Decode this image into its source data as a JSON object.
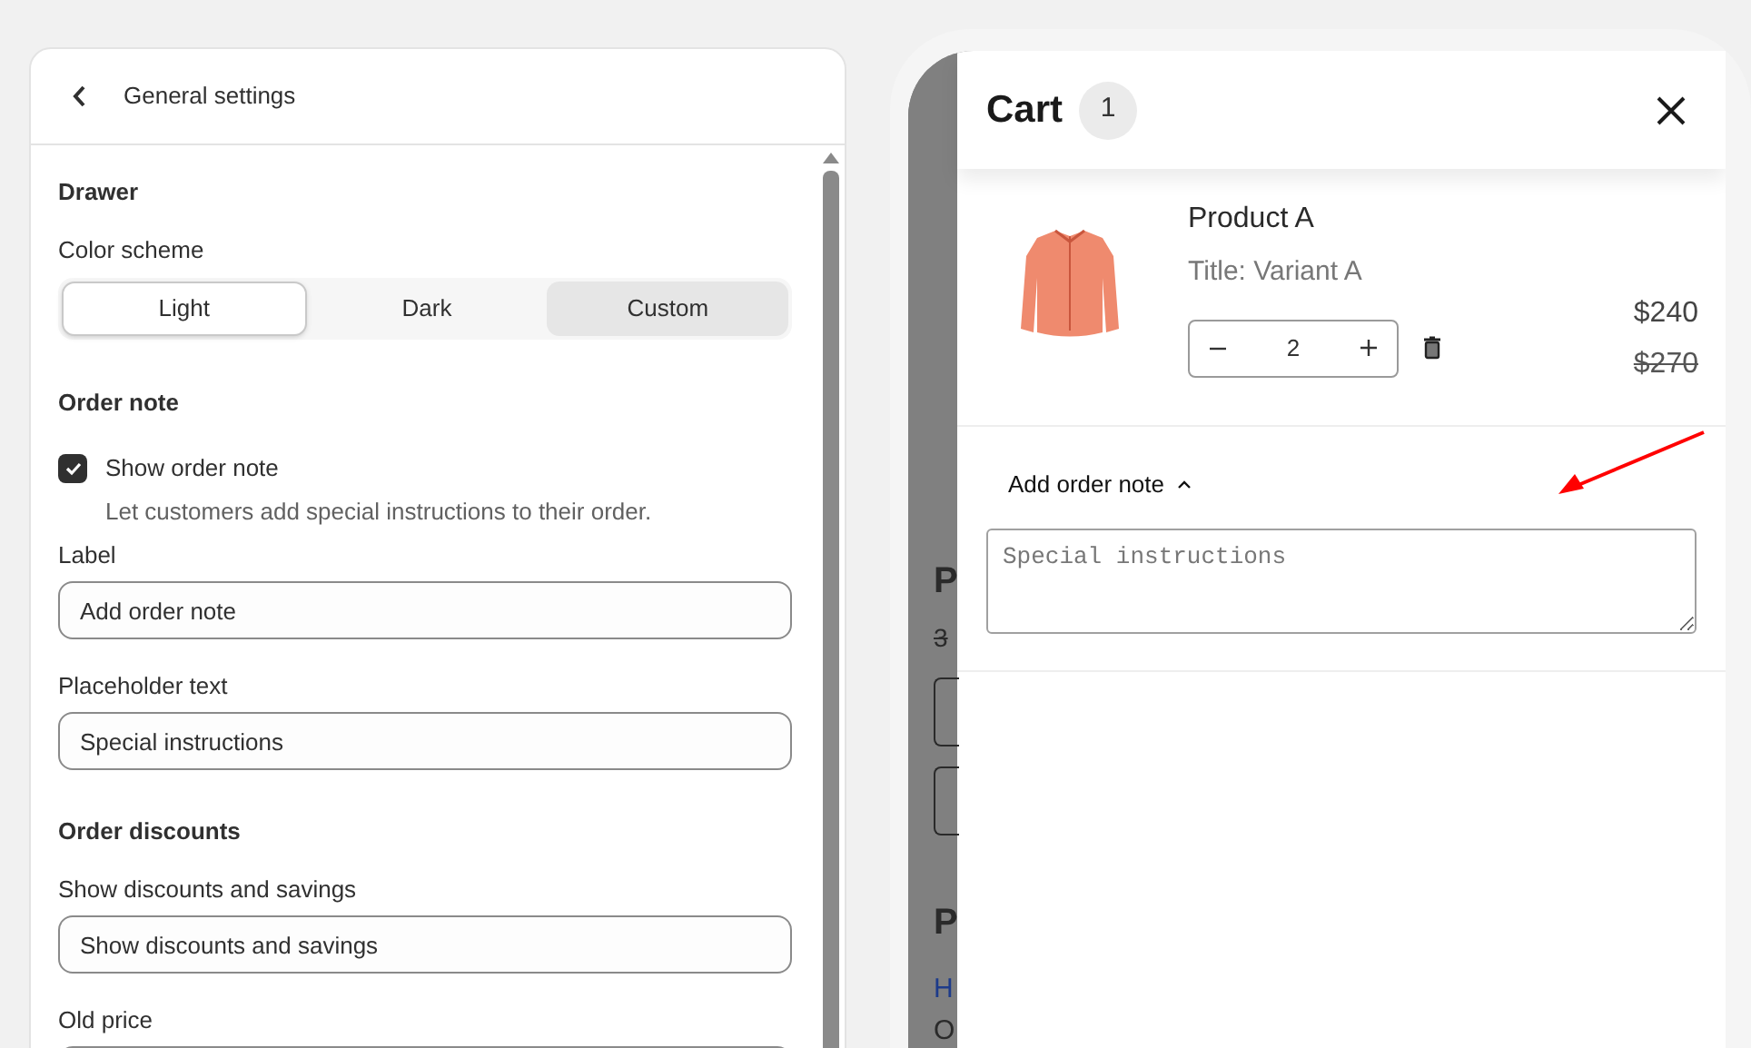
{
  "settings_panel": {
    "title": "General settings",
    "drawer": {
      "heading": "Drawer",
      "color_scheme_label": "Color scheme",
      "color_scheme_options": [
        {
          "label": "Light",
          "selected": true,
          "highlighted": false
        },
        {
          "label": "Dark",
          "selected": false,
          "highlighted": false
        },
        {
          "label": "Custom",
          "selected": false,
          "highlighted": true
        }
      ]
    },
    "order_note": {
      "heading": "Order note",
      "checkbox": {
        "label": "Show order note",
        "checked": true,
        "help": "Let customers add special instructions to their order."
      },
      "fields": [
        {
          "label": "Label",
          "value": "Add order note"
        },
        {
          "label": "Placeholder text",
          "value": "Special instructions"
        }
      ]
    },
    "order_discounts": {
      "heading": "Order discounts",
      "fields": [
        {
          "label": "Show discounts and savings",
          "value": "Show discounts and savings"
        }
      ]
    },
    "old_price_label": "Old price"
  },
  "background_page": {
    "fragments": [
      {
        "kind": "heading",
        "text": "P"
      },
      {
        "kind": "struck",
        "text": "3"
      },
      {
        "kind": "box"
      },
      {
        "kind": "box"
      },
      {
        "kind": "heading",
        "text": "P"
      },
      {
        "kind": "link",
        "text": "H"
      },
      {
        "kind": "plain",
        "text": "O"
      }
    ]
  },
  "cart": {
    "title": "Cart",
    "count": "1",
    "items": [
      {
        "name": "Product A",
        "variant": "Title: Variant A",
        "quantity": "2",
        "price": "$240",
        "old_price": "$270"
      }
    ],
    "order_note": {
      "label": "Add order note",
      "expanded": true,
      "placeholder": "Special instructions"
    }
  }
}
